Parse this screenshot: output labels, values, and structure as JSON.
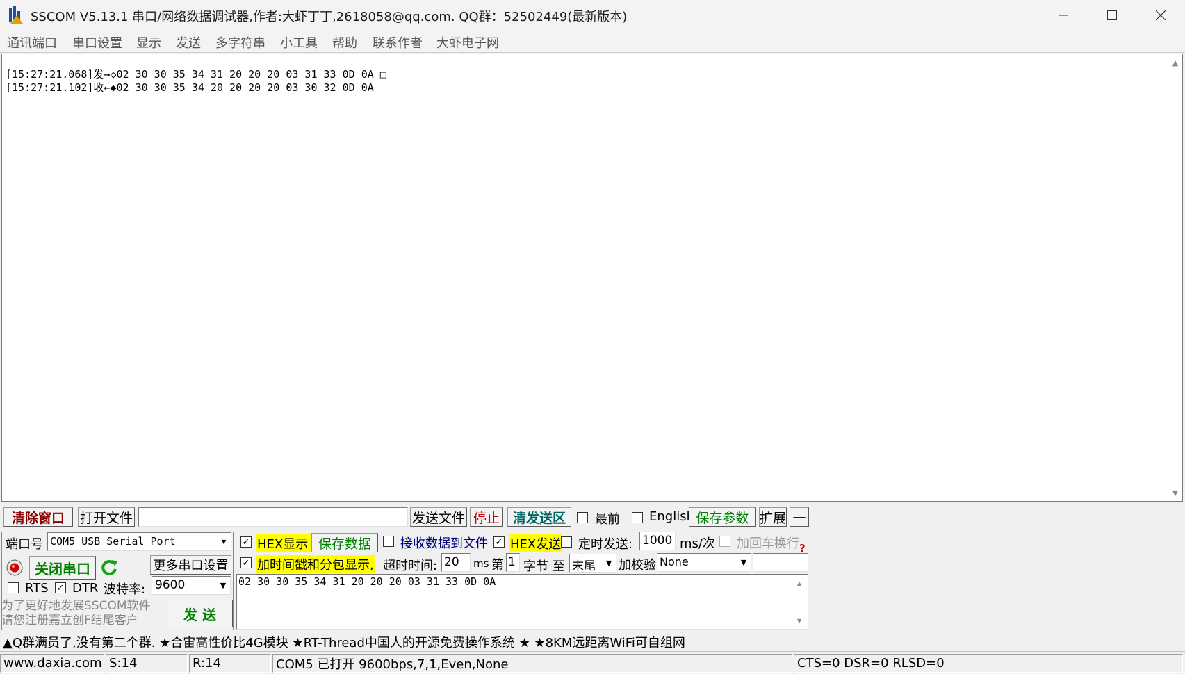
{
  "window": {
    "title": "SSCOM V5.13.1 串口/网络数据调试器,作者:大虾丁丁,2618058@qq.com. QQ群：52502449(最新版本)"
  },
  "menu": [
    "通讯端口",
    "串口设置",
    "显示",
    "发送",
    "多字符串",
    "小工具",
    "帮助",
    "联系作者",
    "大虾电子网"
  ],
  "output": {
    "lines": [
      "[15:27:21.068]发→◇02 30 30 35 34 31 20 20 20 03 31 33 0D 0A □",
      "[15:27:21.102]收←◆02 30 30 35 34 20 20 20 20 03 30 32 0D 0A"
    ]
  },
  "toolbar": {
    "clear": "清除窗口",
    "open_file": "打开文件",
    "file_path": "",
    "send_file": "发送文件",
    "stop": "停止",
    "clear_send": "清发送区",
    "topmost_label": "最前",
    "topmost_checked": false,
    "english_label": "English",
    "english_checked": false,
    "save_params": "保存参数",
    "expand": "扩展",
    "collapse": "—"
  },
  "port": {
    "port_label": "端口号",
    "port_value": "COM5 USB Serial Port",
    "close_port": "关闭串口",
    "more_settings": "更多串口设置",
    "rts_label": "RTS",
    "rts_checked": false,
    "dtr_label": "DTR",
    "dtr_checked": true,
    "baud_label": "波特率:",
    "baud_value": "9600",
    "promo_line1": "为了更好地发展SSCOM软件",
    "promo_line2": "请您注册嘉立创F结尾客户",
    "send": "发  送"
  },
  "options": {
    "hex_display_label": "HEX显示",
    "hex_display_checked": true,
    "save_data": "保存数据",
    "recv_to_file_label": "接收数据到文件",
    "recv_to_file_checked": false,
    "hex_send_label": "HEX发送",
    "hex_send_checked": true,
    "timed_send_label": "定时发送:",
    "timed_send_checked": false,
    "timed_value": "1000",
    "timed_unit": "ms/次",
    "crlf_label": "加回车换行",
    "crlf_checked": false,
    "timestamp_label": "加时间戳和分包显示,",
    "timestamp_checked": true,
    "timeout_label": "超时时间:",
    "timeout_value": "20",
    "timeout_unit": "ms",
    "byte_prefix": "第",
    "byte_from": "1",
    "byte_suffix": "字节 至",
    "byte_to": "末尾",
    "checksum_label": "加校验",
    "checksum_value": "None",
    "checksum_extra": "",
    "help_mark": "?"
  },
  "send_box": {
    "value": "02 30 30 35 34 31 20 20 20 03 31 33 0D 0A"
  },
  "ticker": "▲Q群满员了,没有第二个群. ★合宙高性价比4G模块 ★RT-Thread中国人的开源免费操作系统 ★ ★8KM远距离WiFi可自组网",
  "status": {
    "site": "www.daxia.com",
    "sent": "S:14",
    "recv": "R:14",
    "port_state": "COM5 已打开  9600bps,7,1,Even,None",
    "lines": "CTS=0 DSR=0 RLSD=0"
  },
  "colors": {
    "highlight": "#ffff00",
    "clear_btn_text": "#8b0000",
    "green_btn_text": "#008000",
    "stop_text": "#c00000",
    "blue_text": "#000080",
    "teal_text": "#006666"
  }
}
